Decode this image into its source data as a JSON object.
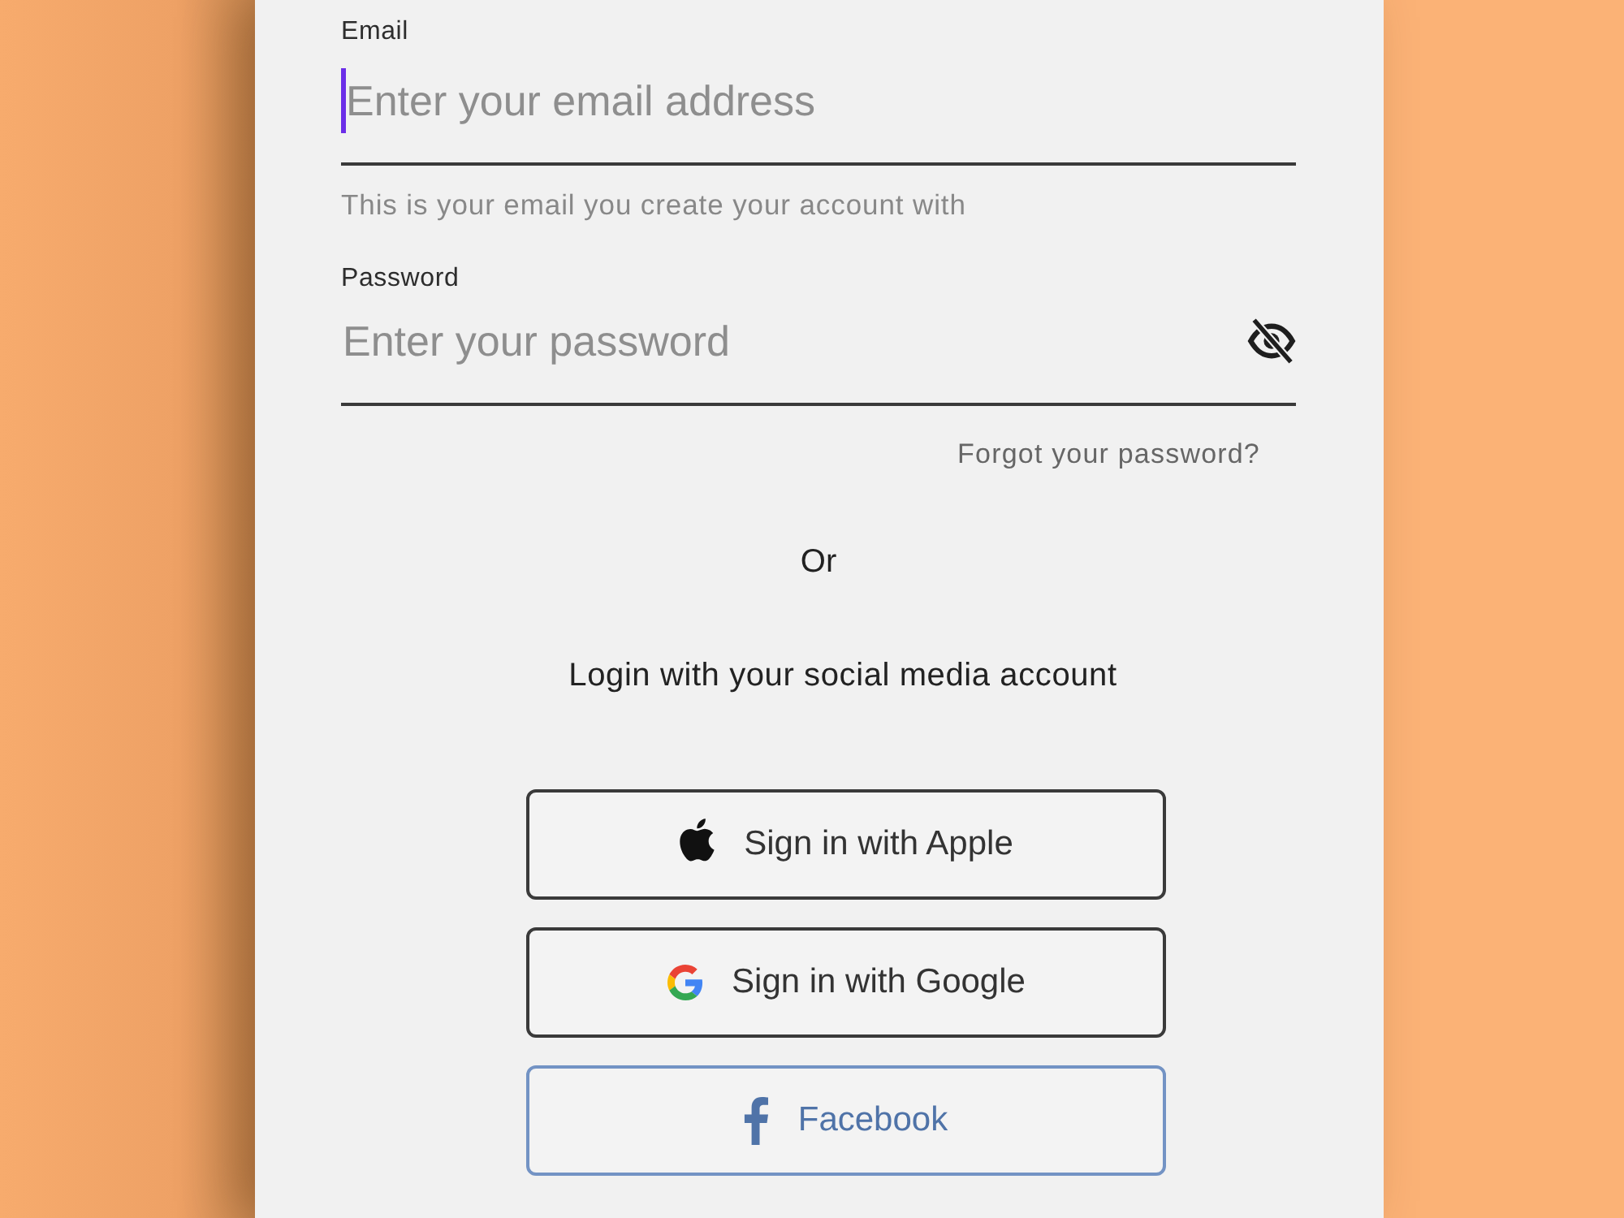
{
  "fields": [
    {
      "kind": "email",
      "label": "Email",
      "placeholder": "Enter your email address",
      "focused": true,
      "helper": "This is your email you create your account with"
    },
    {
      "kind": "password",
      "label": "Password",
      "placeholder": "Enter your password",
      "focused": false,
      "visible": false
    }
  ],
  "forgot_link": "Forgot your password?",
  "divider_text": "Or",
  "social_prompt": "Login with your social media account",
  "social_buttons": [
    {
      "kind": "apple",
      "label": "Sign in with Apple"
    },
    {
      "kind": "google",
      "label": "Sign in with Google"
    },
    {
      "kind": "facebook",
      "label": "Facebook"
    }
  ]
}
